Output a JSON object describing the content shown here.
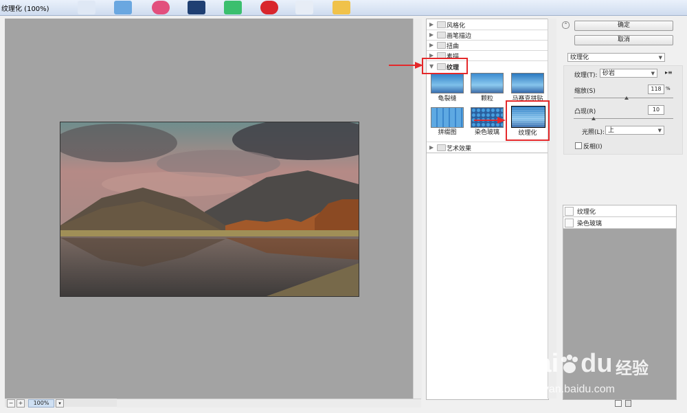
{
  "window": {
    "title": "纹理化 (100%)"
  },
  "colors": {
    "accent_red": "#e4282a",
    "canvas_gray": "#a3a3a3"
  },
  "canvas": {
    "zoom": "100%"
  },
  "filter_gallery": {
    "categories": [
      {
        "label": "风格化",
        "expanded": false
      },
      {
        "label": "画笔描边",
        "expanded": false
      },
      {
        "label": "扭曲",
        "expanded": false
      },
      {
        "label": "素描",
        "expanded": false
      },
      {
        "label": "纹理",
        "expanded": true
      },
      {
        "label": "艺术效果",
        "expanded": false
      }
    ],
    "texture_filters": [
      {
        "label": "龟裂缝"
      },
      {
        "label": "颗粒"
      },
      {
        "label": "马赛克拼贴"
      },
      {
        "label": "拼缀图"
      },
      {
        "label": "染色玻璃"
      },
      {
        "label": "纹理化",
        "selected": true
      }
    ]
  },
  "controls": {
    "ok_label": "确定",
    "cancel_label": "取消",
    "filter_select": "纹理化",
    "texture_label": "纹理(T):",
    "texture_value": "砂岩",
    "scaling_label": "缩放(S)",
    "scaling_value": "118",
    "scaling_unit": "%",
    "scaling_level": 0.53,
    "relief_label": "凸现(R)",
    "relief_value": "10",
    "relief_level": 0.2,
    "light_label": "光照(L):",
    "light_value": "上",
    "invert_label": "反相(I)"
  },
  "layers": [
    {
      "label": "纹理化"
    },
    {
      "label": "染色玻璃"
    }
  ],
  "watermark": {
    "brand": "Bai",
    "brand_tail": "du",
    "cn": "经验",
    "url": "jingyan.baidu.com"
  }
}
